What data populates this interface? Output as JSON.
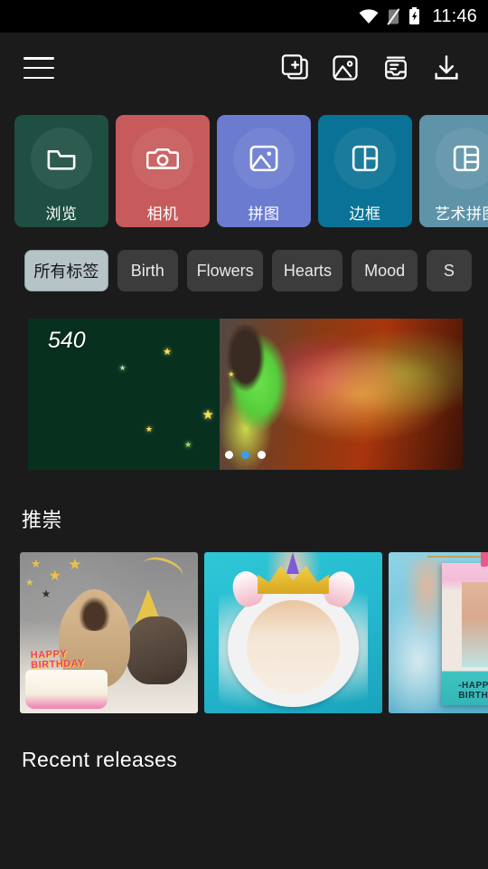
{
  "statusbar": {
    "time": "11:46",
    "icons": [
      "wifi-icon",
      "signal-off-icon",
      "battery-charging-icon"
    ]
  },
  "toolbar": {
    "menu_label": "menu",
    "actions": [
      {
        "name": "add-collage-icon",
        "label": "Add"
      },
      {
        "name": "photo-icon",
        "label": "Photos"
      },
      {
        "name": "inbox-icon",
        "label": "Inbox"
      },
      {
        "name": "download-icon",
        "label": "Download"
      }
    ]
  },
  "cards": [
    {
      "label": "浏览",
      "icon": "folder-icon",
      "color": "#1f4f43"
    },
    {
      "label": "相机",
      "icon": "camera-icon",
      "color": "#c75b5b"
    },
    {
      "label": "拼图",
      "icon": "image-icon",
      "color": "#6b7bd0"
    },
    {
      "label": "边框",
      "icon": "frame-icon",
      "color": "#0a7296"
    },
    {
      "label": "艺术拼图",
      "icon": "art-collage-icon",
      "color": "#5f93a8"
    }
  ],
  "tags": {
    "items": [
      {
        "label": "所有标签",
        "selected": true
      },
      {
        "label": "Birth",
        "selected": false
      },
      {
        "label": "Flowers",
        "selected": false
      },
      {
        "label": "Hearts",
        "selected": false
      },
      {
        "label": "Mood",
        "selected": false
      },
      {
        "label": "S",
        "selected": false
      }
    ],
    "selected_bg": "#b6c4c8",
    "unselected_bg": "#3c3c3c"
  },
  "banner": {
    "overlay_text": "540",
    "dots": {
      "count": 3,
      "active_index": 1,
      "active_color": "#3b9bf0"
    }
  },
  "sections": [
    {
      "title": "推崇"
    },
    {
      "title": "Recent releases"
    }
  ],
  "featured": [
    {
      "name": "pug-cat-birthday",
      "caption": "HAPPY\nBIRTHDAY"
    },
    {
      "name": "unicorn-frame",
      "caption": ""
    },
    {
      "name": "polaroid-birthday",
      "caption": "-HAPPY-\nBIRTHDAY"
    }
  ],
  "colors": {
    "background": "#1b1b1b",
    "statusbar": "#000000",
    "text_primary": "#ffffff",
    "accent": "#3b9bf0"
  }
}
